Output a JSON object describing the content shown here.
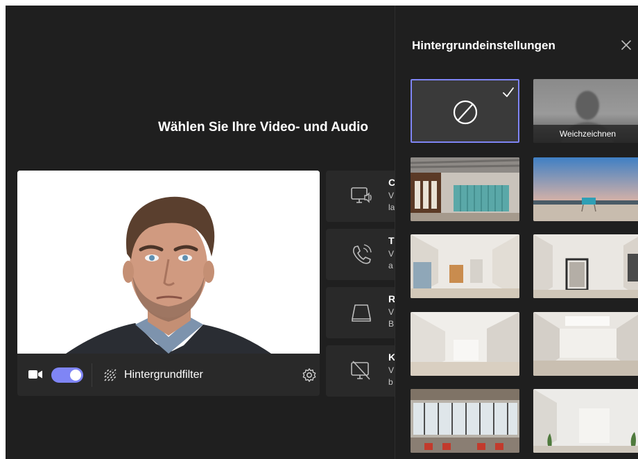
{
  "prejoin": {
    "title": "Wählen Sie Ihre Video- und Audio",
    "video_controls": {
      "camera_on": true,
      "background_filter_label": "Hintergrundfilter"
    },
    "audio_options": [
      {
        "icon": "computer-audio-icon",
        "title": "C",
        "desc": [
          "V",
          "la"
        ]
      },
      {
        "icon": "phone-audio-icon",
        "title": "T",
        "desc": [
          "V",
          "a"
        ]
      },
      {
        "icon": "room-audio-icon",
        "title": "R",
        "desc": [
          "V",
          "B"
        ]
      },
      {
        "icon": "no-audio-icon",
        "title": "K",
        "desc": [
          "V",
          "b"
        ]
      }
    ]
  },
  "bg_panel": {
    "title": "Hintergrundeinstellungen",
    "tiles": [
      {
        "kind": "none",
        "selected": true,
        "icon": "none-icon"
      },
      {
        "kind": "blur",
        "caption": "Weichzeichnen"
      },
      {
        "kind": "image",
        "scene": "loft office with lockers"
      },
      {
        "kind": "image",
        "scene": "beach with lifeguard tower"
      },
      {
        "kind": "image",
        "scene": "bright minimal room"
      },
      {
        "kind": "image",
        "scene": "white room with mirror"
      },
      {
        "kind": "image",
        "scene": "white gallery space"
      },
      {
        "kind": "image",
        "scene": "white studio with skylight"
      },
      {
        "kind": "image",
        "scene": "industrial office with red chairs"
      },
      {
        "kind": "image",
        "scene": "white room with plants"
      }
    ]
  },
  "colors": {
    "app_bg": "#1f1f1f",
    "card_bg": "#292929",
    "accent": "#7f85f5"
  }
}
